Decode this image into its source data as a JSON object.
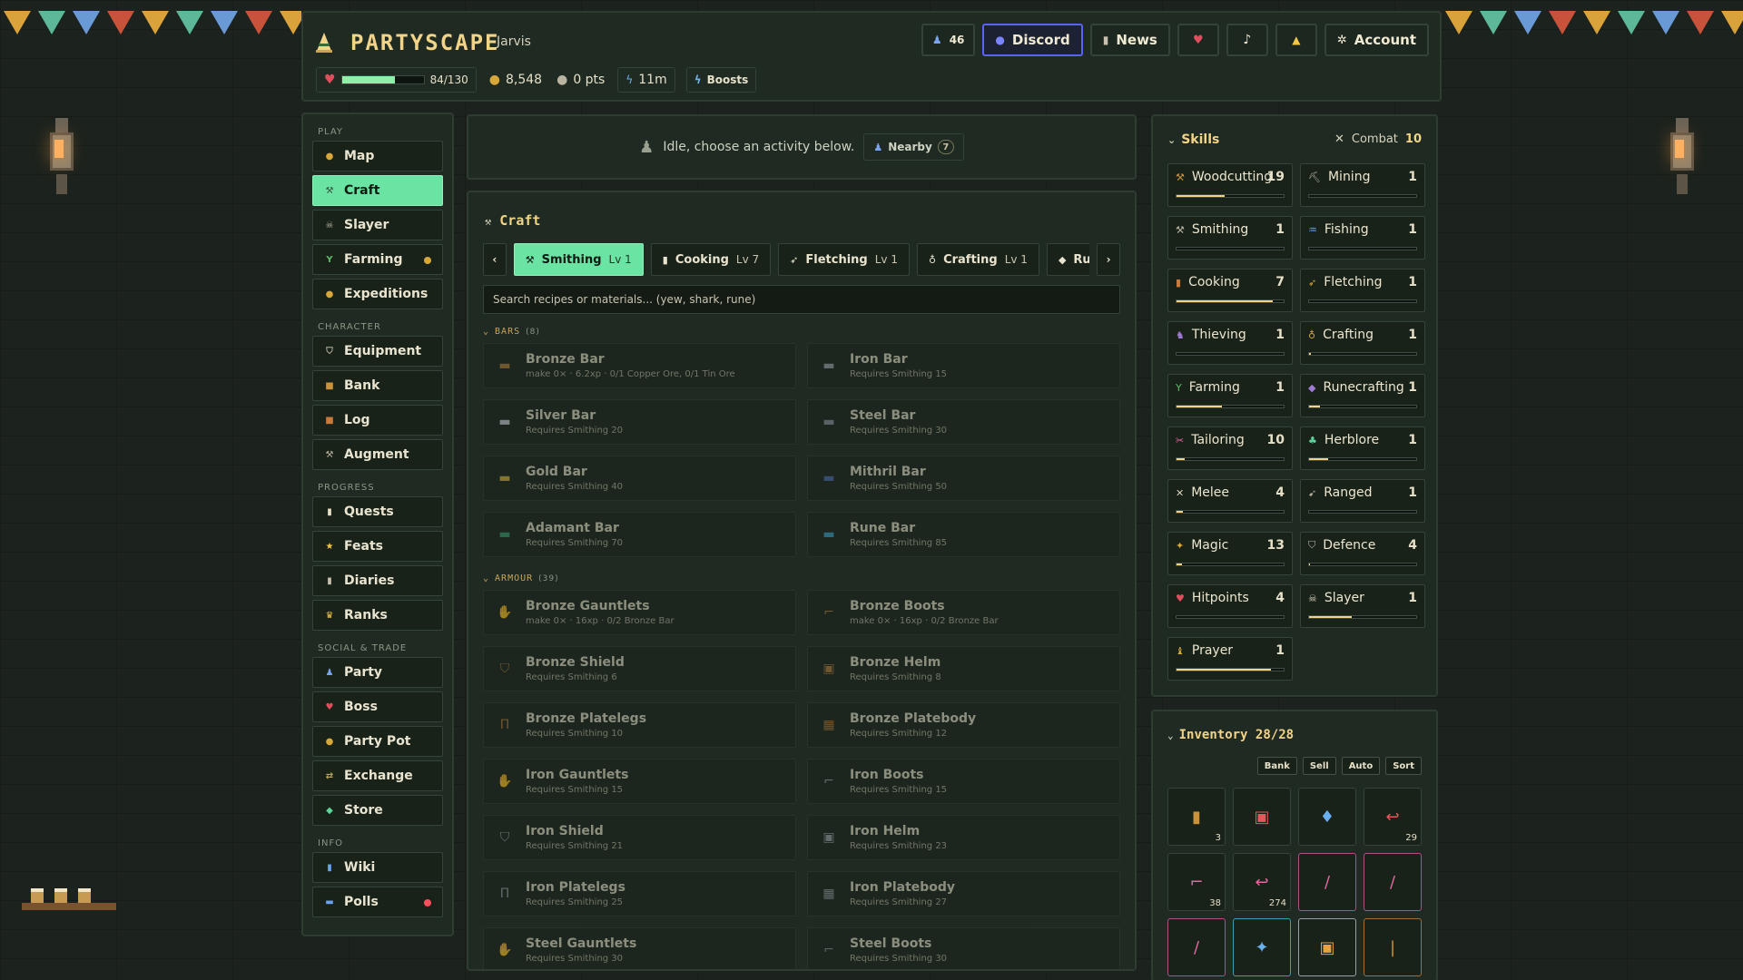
{
  "colors": {
    "accent": "#6be3a2",
    "gold": "#f2d488",
    "panel": "#1f2a22",
    "discord": "#5865f2",
    "hp": "#e04e5e",
    "alert": "#ff4f5e",
    "idle": "#d6a73a"
  },
  "header": {
    "brand": "PARTYSCAPE",
    "username": "Jarvis",
    "online_count": "46",
    "discord_label": "Discord",
    "news_label": "News",
    "account_label": "Account",
    "hp_text": "84/130",
    "hp_fraction": 0.646,
    "gold": "8,548",
    "points": "0 pts",
    "boost_time": "11m",
    "boosts_label": "Boosts"
  },
  "sidebar": {
    "sections": [
      {
        "title": "PLAY",
        "items": [
          {
            "label": "Map",
            "icon": "map-icon",
            "glyph": "●",
            "color": "#d6a73a",
            "active": false
          },
          {
            "label": "Craft",
            "icon": "hammer-icon",
            "glyph": "⚒",
            "color": "#35543f",
            "active": true
          },
          {
            "label": "Slayer",
            "icon": "skull-icon",
            "glyph": "☠",
            "color": "#b9b3a0",
            "active": false
          },
          {
            "label": "Farming",
            "icon": "sprout-icon",
            "glyph": "Y",
            "color": "#5db86a",
            "active": false,
            "dot": "#d6a73a"
          },
          {
            "label": "Expeditions",
            "icon": "compass-icon",
            "glyph": "●",
            "color": "#d6a73a",
            "active": false
          }
        ]
      },
      {
        "title": "CHARACTER",
        "items": [
          {
            "label": "Equipment",
            "icon": "shield-icon",
            "glyph": "⛉",
            "color": "#b9b3a0",
            "active": false
          },
          {
            "label": "Bank",
            "icon": "chest-icon",
            "glyph": "■",
            "color": "#c8933a",
            "active": false
          },
          {
            "label": "Log",
            "icon": "book-icon",
            "glyph": "■",
            "color": "#c87a3a",
            "active": false
          },
          {
            "label": "Augment",
            "icon": "wand-icon",
            "glyph": "⚒",
            "color": "#b9b3a0",
            "active": false
          }
        ]
      },
      {
        "title": "PROGRESS",
        "items": [
          {
            "label": "Quests",
            "icon": "scroll-icon",
            "glyph": "▮",
            "color": "#e8e0c8",
            "active": false
          },
          {
            "label": "Feats",
            "icon": "star-icon",
            "glyph": "★",
            "color": "#f2c84b",
            "active": false
          },
          {
            "label": "Diaries",
            "icon": "diary-icon",
            "glyph": "▮",
            "color": "#c8c0ae",
            "active": false
          },
          {
            "label": "Ranks",
            "icon": "trophy-icon",
            "glyph": "♛",
            "color": "#f2c84b",
            "active": false
          }
        ]
      },
      {
        "title": "SOCIAL & TRADE",
        "items": [
          {
            "label": "Party",
            "icon": "people-icon",
            "glyph": "♟",
            "color": "#7aa4f0",
            "active": false
          },
          {
            "label": "Boss",
            "icon": "boss-icon",
            "glyph": "♥",
            "color": "#e04e5e",
            "active": false
          },
          {
            "label": "Party Pot",
            "icon": "pot-icon",
            "glyph": "●",
            "color": "#d6a73a",
            "active": false
          },
          {
            "label": "Exchange",
            "icon": "exchange-icon",
            "glyph": "⇄",
            "color": "#b9a85a",
            "active": false
          },
          {
            "label": "Store",
            "icon": "gem-icon",
            "glyph": "◆",
            "color": "#5dd49a",
            "active": false
          }
        ]
      },
      {
        "title": "INFO",
        "items": [
          {
            "label": "Wiki",
            "icon": "wiki-icon",
            "glyph": "▮",
            "color": "#6aa4f0",
            "active": false
          },
          {
            "label": "Polls",
            "icon": "poll-icon",
            "glyph": "▬",
            "color": "#6aa4f0",
            "active": false,
            "dot": "#ff4f5e"
          }
        ]
      }
    ]
  },
  "status": {
    "text": "Idle, choose an activity below.",
    "nearby_label": "Nearby",
    "nearby_count": "7"
  },
  "craft": {
    "title": "Craft",
    "tabs": [
      {
        "label": "Smithing",
        "level": "Lv 1",
        "glyph": "⚒",
        "active": true
      },
      {
        "label": "Cooking",
        "level": "Lv 7",
        "glyph": "▮",
        "active": false
      },
      {
        "label": "Fletching",
        "level": "Lv 1",
        "glyph": "➶",
        "active": false
      },
      {
        "label": "Crafting",
        "level": "Lv 1",
        "glyph": "♁",
        "active": false
      },
      {
        "label": "Runecrafting",
        "level": "",
        "glyph": "◆",
        "active": false
      }
    ],
    "search_placeholder": "Search recipes or materials... (yew, shark, rune)",
    "categories": [
      {
        "name": "BARS",
        "count": "(8)",
        "recipes": [
          {
            "name": "Bronze Bar",
            "sub": "make 0× · 6.2xp · 0/1 Copper Ore, 0/1 Tin Ore",
            "color": "#b07a3a",
            "glyph": "▬"
          },
          {
            "name": "Iron Bar",
            "sub": "Requires Smithing 15",
            "color": "#9aa0a8",
            "glyph": "▬"
          },
          {
            "name": "Silver Bar",
            "sub": "Requires Smithing 20",
            "color": "#c8ccd4",
            "glyph": "▬"
          },
          {
            "name": "Steel Bar",
            "sub": "Requires Smithing 30",
            "color": "#8a929c",
            "glyph": "▬"
          },
          {
            "name": "Gold Bar",
            "sub": "Requires Smithing 40",
            "color": "#d6b13a",
            "glyph": "▬"
          },
          {
            "name": "Mithril Bar",
            "sub": "Requires Smithing 50",
            "color": "#4a6ab0",
            "glyph": "▬"
          },
          {
            "name": "Adamant Bar",
            "sub": "Requires Smithing 70",
            "color": "#3a9a6a",
            "glyph": "▬"
          },
          {
            "name": "Rune Bar",
            "sub": "Requires Smithing 85",
            "color": "#3aa0c8",
            "glyph": "▬"
          }
        ]
      },
      {
        "name": "ARMOUR",
        "count": "(39)",
        "recipes": [
          {
            "name": "Bronze Gauntlets",
            "sub": "make 0× · 16xp · 0/2 Bronze Bar",
            "color": "#b07a3a",
            "glyph": "✋"
          },
          {
            "name": "Bronze Boots",
            "sub": "make 0× · 16xp · 0/2 Bronze Bar",
            "color": "#b07a3a",
            "glyph": "⌐"
          },
          {
            "name": "Bronze Shield",
            "sub": "Requires Smithing 6",
            "color": "#b07a3a",
            "glyph": "⛉"
          },
          {
            "name": "Bronze Helm",
            "sub": "Requires Smithing 8",
            "color": "#b07a3a",
            "glyph": "▣"
          },
          {
            "name": "Bronze Platelegs",
            "sub": "Requires Smithing 10",
            "color": "#b07a3a",
            "glyph": "Π"
          },
          {
            "name": "Bronze Platebody",
            "sub": "Requires Smithing 12",
            "color": "#b07a3a",
            "glyph": "▦"
          },
          {
            "name": "Iron Gauntlets",
            "sub": "Requires Smithing 15",
            "color": "#9aa0a8",
            "glyph": "✋"
          },
          {
            "name": "Iron Boots",
            "sub": "Requires Smithing 15",
            "color": "#9aa0a8",
            "glyph": "⌐"
          },
          {
            "name": "Iron Shield",
            "sub": "Requires Smithing 21",
            "color": "#9aa0a8",
            "glyph": "⛉"
          },
          {
            "name": "Iron Helm",
            "sub": "Requires Smithing 23",
            "color": "#9aa0a8",
            "glyph": "▣"
          },
          {
            "name": "Iron Platelegs",
            "sub": "Requires Smithing 25",
            "color": "#9aa0a8",
            "glyph": "Π"
          },
          {
            "name": "Iron Platebody",
            "sub": "Requires Smithing 27",
            "color": "#9aa0a8",
            "glyph": "▦"
          },
          {
            "name": "Steel Gauntlets",
            "sub": "Requires Smithing 30",
            "color": "#8a929c",
            "glyph": "✋"
          },
          {
            "name": "Steel Boots",
            "sub": "Requires Smithing 30",
            "color": "#8a929c",
            "glyph": "⌐"
          }
        ]
      }
    ]
  },
  "skills": {
    "title": "Skills",
    "combat_label": "Combat",
    "combat_level": "10",
    "list": [
      {
        "name": "Woodcutting",
        "level": "19",
        "progress": 0.45,
        "glyph": "⚒",
        "color": "#c8933a"
      },
      {
        "name": "Mining",
        "level": "1",
        "progress": 0.0,
        "glyph": "⛏",
        "color": "#b9b3a0"
      },
      {
        "name": "Smithing",
        "level": "1",
        "progress": 0.0,
        "glyph": "⚒",
        "color": "#b9b3a0"
      },
      {
        "name": "Fishing",
        "level": "1",
        "progress": 0.0,
        "glyph": "♒",
        "color": "#6aa4f0"
      },
      {
        "name": "Cooking",
        "level": "7",
        "progress": 0.9,
        "glyph": "▮",
        "color": "#c87a3a"
      },
      {
        "name": "Fletching",
        "level": "1",
        "progress": 0.0,
        "glyph": "➶",
        "color": "#d6a73a"
      },
      {
        "name": "Thieving",
        "level": "1",
        "progress": 0.0,
        "glyph": "♞",
        "color": "#a07ad6"
      },
      {
        "name": "Crafting",
        "level": "1",
        "progress": 0.02,
        "glyph": "♁",
        "color": "#d6a73a"
      },
      {
        "name": "Farming",
        "level": "1",
        "progress": 0.42,
        "glyph": "Y",
        "color": "#5db86a"
      },
      {
        "name": "Runecrafting",
        "level": "1",
        "progress": 0.1,
        "glyph": "◆",
        "color": "#a07ad6"
      },
      {
        "name": "Tailoring",
        "level": "10",
        "progress": 0.08,
        "glyph": "✂",
        "color": "#e06aa0"
      },
      {
        "name": "Herblore",
        "level": "1",
        "progress": 0.18,
        "glyph": "♣",
        "color": "#5dd49a"
      },
      {
        "name": "Melee",
        "level": "4",
        "progress": 0.06,
        "glyph": "✕",
        "color": "#d6d2bd"
      },
      {
        "name": "Ranged",
        "level": "1",
        "progress": 0.0,
        "glyph": "➹",
        "color": "#b9b3a0"
      },
      {
        "name": "Magic",
        "level": "13",
        "progress": 0.05,
        "glyph": "✦",
        "color": "#d6a73a"
      },
      {
        "name": "Defence",
        "level": "4",
        "progress": 0.01,
        "glyph": "⛉",
        "color": "#b9b3a0"
      },
      {
        "name": "Hitpoints",
        "level": "4",
        "progress": 0.0,
        "glyph": "♥",
        "color": "#e04e5e"
      },
      {
        "name": "Slayer",
        "level": "1",
        "progress": 0.4,
        "glyph": "☠",
        "color": "#d6d2bd"
      },
      {
        "name": "Prayer",
        "level": "1",
        "progress": 0.88,
        "glyph": "♝",
        "color": "#d6a73a"
      }
    ]
  },
  "inventory": {
    "title": "Inventory 28/28",
    "buttons": [
      "Bank",
      "Sell",
      "Auto",
      "Sort"
    ],
    "slots": [
      {
        "item": "lantern-icon",
        "glyph": "▮",
        "color": "#c8933a",
        "qty": "3",
        "border": ""
      },
      {
        "item": "scroll-icon",
        "glyph": "▣",
        "color": "#e05a5a",
        "qty": "",
        "border": ""
      },
      {
        "item": "potion-icon",
        "glyph": "♦",
        "color": "#6ab0f0",
        "qty": "",
        "border": ""
      },
      {
        "item": "shrimp-icon",
        "glyph": "↩",
        "color": "#e05a5a",
        "qty": "29",
        "border": ""
      },
      {
        "item": "boot-icon",
        "glyph": "⌐",
        "color": "#e06aa0",
        "qty": "38",
        "border": ""
      },
      {
        "item": "shrimp-icon",
        "glyph": "↩",
        "color": "#e06aa0",
        "qty": "274",
        "border": ""
      },
      {
        "item": "wand-icon",
        "glyph": "/",
        "color": "#e06aa0",
        "qty": "",
        "border": "#b0508a"
      },
      {
        "item": "wand-icon",
        "glyph": "/",
        "color": "#e06aa0",
        "qty": "",
        "border": "#b0508a"
      },
      {
        "item": "wand-icon",
        "glyph": "/",
        "color": "#e06aa0",
        "qty": "",
        "border": "#b0508a"
      },
      {
        "item": "staff-icon",
        "glyph": "✦",
        "color": "#6ab0f0",
        "qty": "",
        "border": "#3aa0b0"
      },
      {
        "item": "helmet-icon",
        "glyph": "▣",
        "color": "#e8a040",
        "qty": "",
        "border": "#9aa0a8"
      },
      {
        "item": "arrow-icon",
        "glyph": "|",
        "color": "#c8933a",
        "qty": "",
        "border": "#a0703a"
      }
    ]
  }
}
